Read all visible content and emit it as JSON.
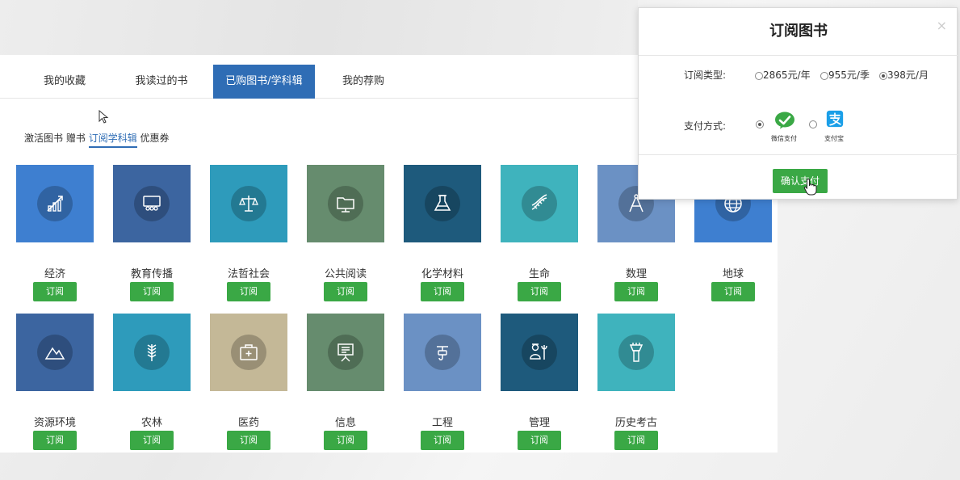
{
  "tabs": [
    "我的收藏",
    "我读过的书",
    "已购图书/学科辑",
    "我的荐购"
  ],
  "subtabs": [
    "激活图书",
    "赠书",
    "订阅学科辑",
    "优惠券"
  ],
  "subscribe_label": "订阅",
  "categories_row1": [
    {
      "name": "经济",
      "icon": "bar-chart-icon",
      "color": "#3e7fd0"
    },
    {
      "name": "教育传播",
      "icon": "classroom-icon",
      "color": "#3c65a0"
    },
    {
      "name": "法哲社会",
      "icon": "scales-icon",
      "color": "#2e9bbb"
    },
    {
      "name": "公共阅读",
      "icon": "folder-screen-icon",
      "color": "#668c6e"
    },
    {
      "name": "化学材料",
      "icon": "lab-flask-icon",
      "color": "#1e5a7c"
    },
    {
      "name": "生命",
      "icon": "dna-icon",
      "color": "#3fb3bd"
    },
    {
      "name": "数理",
      "icon": "compass-icon",
      "color": "#6b91c4"
    },
    {
      "name": "地球",
      "icon": "globe-icon",
      "color": "#3e7fd0"
    }
  ],
  "categories_row2": [
    {
      "name": "资源环境",
      "icon": "mountain-icon",
      "color": "#3c65a0"
    },
    {
      "name": "农林",
      "icon": "wheat-icon",
      "color": "#2e9bbb"
    },
    {
      "name": "医药",
      "icon": "medical-kit-icon",
      "color": "#c4b897"
    },
    {
      "name": "信息",
      "icon": "presentation-icon",
      "color": "#668c6e"
    },
    {
      "name": "工程",
      "icon": "crane-hook-icon",
      "color": "#6b91c4"
    },
    {
      "name": "管理",
      "icon": "manager-tools-icon",
      "color": "#1e5a7c"
    },
    {
      "name": "历史考古",
      "icon": "torch-icon",
      "color": "#3fb3bd"
    }
  ],
  "modal": {
    "title": "订阅图书",
    "close": "×",
    "type_label": "订阅类型:",
    "type_options": [
      "2865元/年",
      "955元/季",
      "398元/月"
    ],
    "selected_type": "398元/月",
    "pay_label": "支付方式:",
    "pay_options": [
      "微信支付",
      "支付宝"
    ],
    "selected_pay": "微信支付",
    "confirm": "确认支付"
  }
}
